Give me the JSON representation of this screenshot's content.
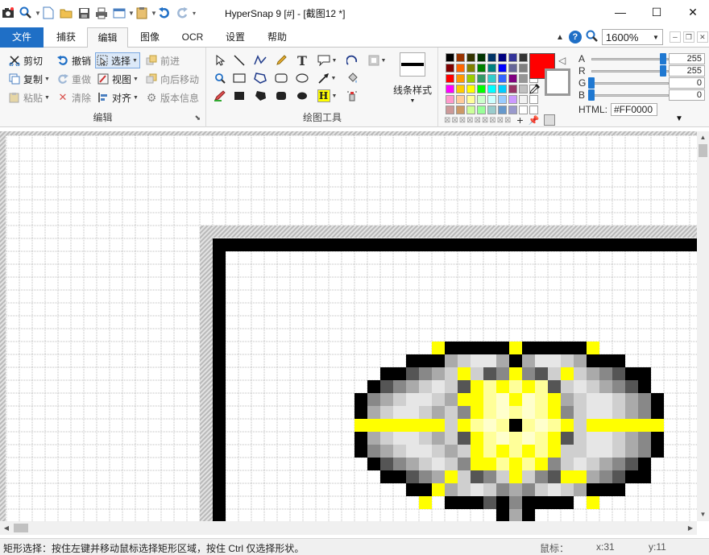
{
  "window": {
    "title": "HyperSnap 9 [#] - [截图12 *]",
    "minimize_icon": "minimize-icon",
    "maximize_icon": "maximize-icon",
    "close_icon": "close-icon"
  },
  "tabs": [
    "文件",
    "捕获",
    "编辑",
    "图像",
    "OCR",
    "设置",
    "帮助"
  ],
  "active_tab": "编辑",
  "zoom": "1600%",
  "edit_group": {
    "label": "编辑",
    "cut": "剪切",
    "copy": "复制",
    "paste": "粘贴",
    "undo": "撤销",
    "redo": "重做",
    "clear": "清除",
    "select": "选择",
    "view": "视图",
    "align": "对齐",
    "forward": "前进",
    "backward": "向后移动",
    "version": "版本信息"
  },
  "draw_group": {
    "label": "绘图工具",
    "line_style": "线条样式"
  },
  "colors": {
    "current": "#FF0000",
    "html_label": "HTML:",
    "html_value": "#FF0000",
    "a_label": "A",
    "a_value": "255",
    "r_label": "R",
    "r_value": "255",
    "g_label": "G",
    "g_value": "0",
    "b_label": "B",
    "b_value": "0",
    "palette": [
      "#000000",
      "#993300",
      "#333300",
      "#003300",
      "#003366",
      "#000080",
      "#333399",
      "#333333",
      "#ffffff",
      "#800000",
      "#ff6600",
      "#808000",
      "#008000",
      "#008080",
      "#0000ff",
      "#666699",
      "#808080",
      "#ffffff",
      "#ff0000",
      "#ff9900",
      "#99cc00",
      "#339966",
      "#33cccc",
      "#3366ff",
      "#800080",
      "#969696",
      "#ffffff",
      "#ff00ff",
      "#ffcc00",
      "#ffff00",
      "#00ff00",
      "#00ffff",
      "#00ccff",
      "#993366",
      "#c0c0c0",
      "#ffffff",
      "#ff99cc",
      "#ffcc99",
      "#ffff99",
      "#ccffcc",
      "#ccffff",
      "#99ccff",
      "#cc99ff",
      "#f2f2f2",
      "#ffffff",
      "#cc9999",
      "#cc9966",
      "#ccff99",
      "#99ff99",
      "#99cccc",
      "#6699cc",
      "#9999cc",
      "#ffffff",
      "#ffffff"
    ]
  },
  "status": {
    "hint": "矩形选择：按住左键并移动鼠标选择矩形区域，按住 Ctrl 仅选择形状。",
    "mouse_label": "鼠标：",
    "x": "x:31",
    "y": "y:11"
  }
}
